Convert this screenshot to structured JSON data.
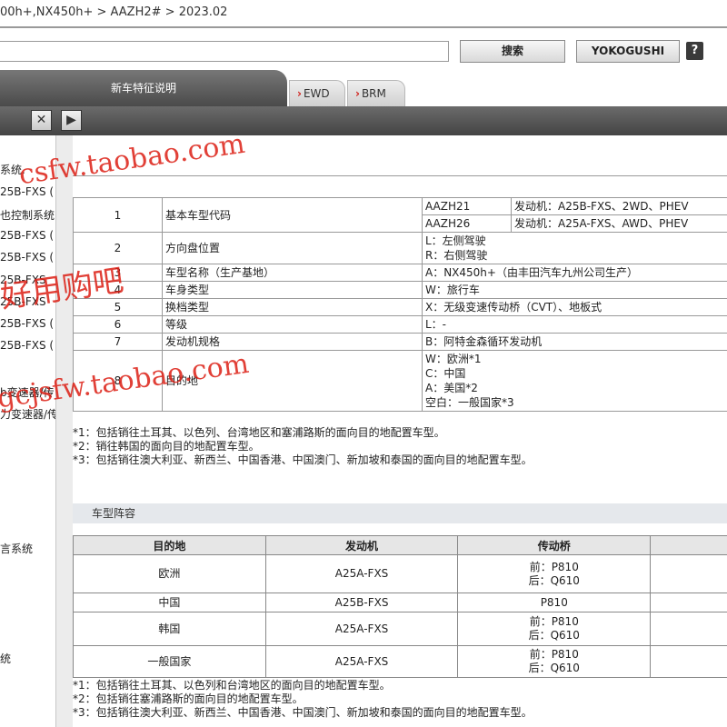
{
  "breadcrumb": "00h+,NX450h+ > AAZH2# > 2023.02",
  "search": {
    "value": "",
    "button": "搜索"
  },
  "yokogushi_button": "YOKOGUSHI",
  "help_button": "?",
  "tabs": {
    "main": "新车特征说明",
    "ewd": "EWD",
    "brm": "BRM"
  },
  "toolbar": {
    "close": "✕",
    "play": "▶"
  },
  "sidebar": [
    {
      "label": "系统."
    },
    {
      "label": "25B-FXS ("
    },
    {
      "label": "也控制系统"
    },
    {
      "label": "25B-FXS ("
    },
    {
      "label": "25B-FXS ("
    },
    {
      "label": "25B-FXS"
    },
    {
      "label": "25B-FXS"
    },
    {
      "label": "25B-FXS ("
    },
    {
      "label": "25B-FXS ("
    },
    {
      "label": "b变速器/传"
    },
    {
      "label": "力变速器/传"
    },
    {
      "label": "言系统"
    },
    {
      "label": "统"
    }
  ],
  "codes": [
    {
      "no": "1",
      "desc": "基本车型代码",
      "vals": [
        "AAZH21",
        "AAZH26"
      ],
      "details": [
        "发动机：A25B-FXS、2WD、PHEV",
        "发动机：A25A-FXS、AWD、PHEV"
      ]
    },
    {
      "no": "2",
      "desc": "方向盘位置",
      "vals": [
        "L：左侧驾驶",
        "R：右侧驾驶"
      ]
    },
    {
      "no": "3",
      "desc": "车型名称（生产基地）",
      "vals": [
        "A：NX450h+（由丰田汽车九州公司生产）"
      ]
    },
    {
      "no": "4",
      "desc": "车身类型",
      "vals": [
        "W：旅行车"
      ]
    },
    {
      "no": "5",
      "desc": "换档类型",
      "vals": [
        "X：无级变速传动桥（CVT）、地板式"
      ]
    },
    {
      "no": "6",
      "desc": "等级",
      "vals": [
        "L：-"
      ]
    },
    {
      "no": "7",
      "desc": "发动机规格",
      "vals": [
        "B：阿特金森循环发动机"
      ]
    },
    {
      "no": "8",
      "desc": "目的地",
      "vals": [
        "W：欧洲*1",
        "C：中国",
        "A：美国*2",
        "空白：一般国家*3"
      ]
    }
  ],
  "notes1": [
    "*1：包括销往土耳其、以色列、台湾地区和塞浦路斯的面向目的地配置车型。",
    "*2：销往韩国的面向目的地配置车型。",
    "*3：包括销往澳大利亚、新西兰、中国香港、中国澳门、新加坡和泰国的面向目的地配置车型。"
  ],
  "lineup_title": "车型阵容",
  "lineup": {
    "headers": [
      "目的地",
      "发动机",
      "传动桥"
    ],
    "rows": [
      {
        "dest": "欧洲",
        "engine": "A25A-FXS",
        "trans": [
          "前：P810",
          "后：Q610"
        ]
      },
      {
        "dest": "中国",
        "engine": "A25B-FXS",
        "trans": [
          "P810"
        ]
      },
      {
        "dest": "韩国",
        "engine": "A25A-FXS",
        "trans": [
          "前：P810",
          "后：Q610"
        ]
      },
      {
        "dest": "一般国家",
        "engine": "A25A-FXS",
        "trans": [
          "前：P810",
          "后：Q610"
        ]
      }
    ]
  },
  "notes2": [
    "*1：包括销往土耳其、以色列和台湾地区的面向目的地配置车型。",
    "*2：包括销往塞浦路斯的面向目的地配置车型。",
    "*3：包括销往澳大利亚、新西兰、中国香港、中国澳门、新加坡和泰国的面向目的地配置车型。"
  ],
  "watermarks": {
    "w1": "csfw.taobao.com",
    "w2": "好用购吧",
    "w3": "gcjsfw.taobao.com"
  }
}
